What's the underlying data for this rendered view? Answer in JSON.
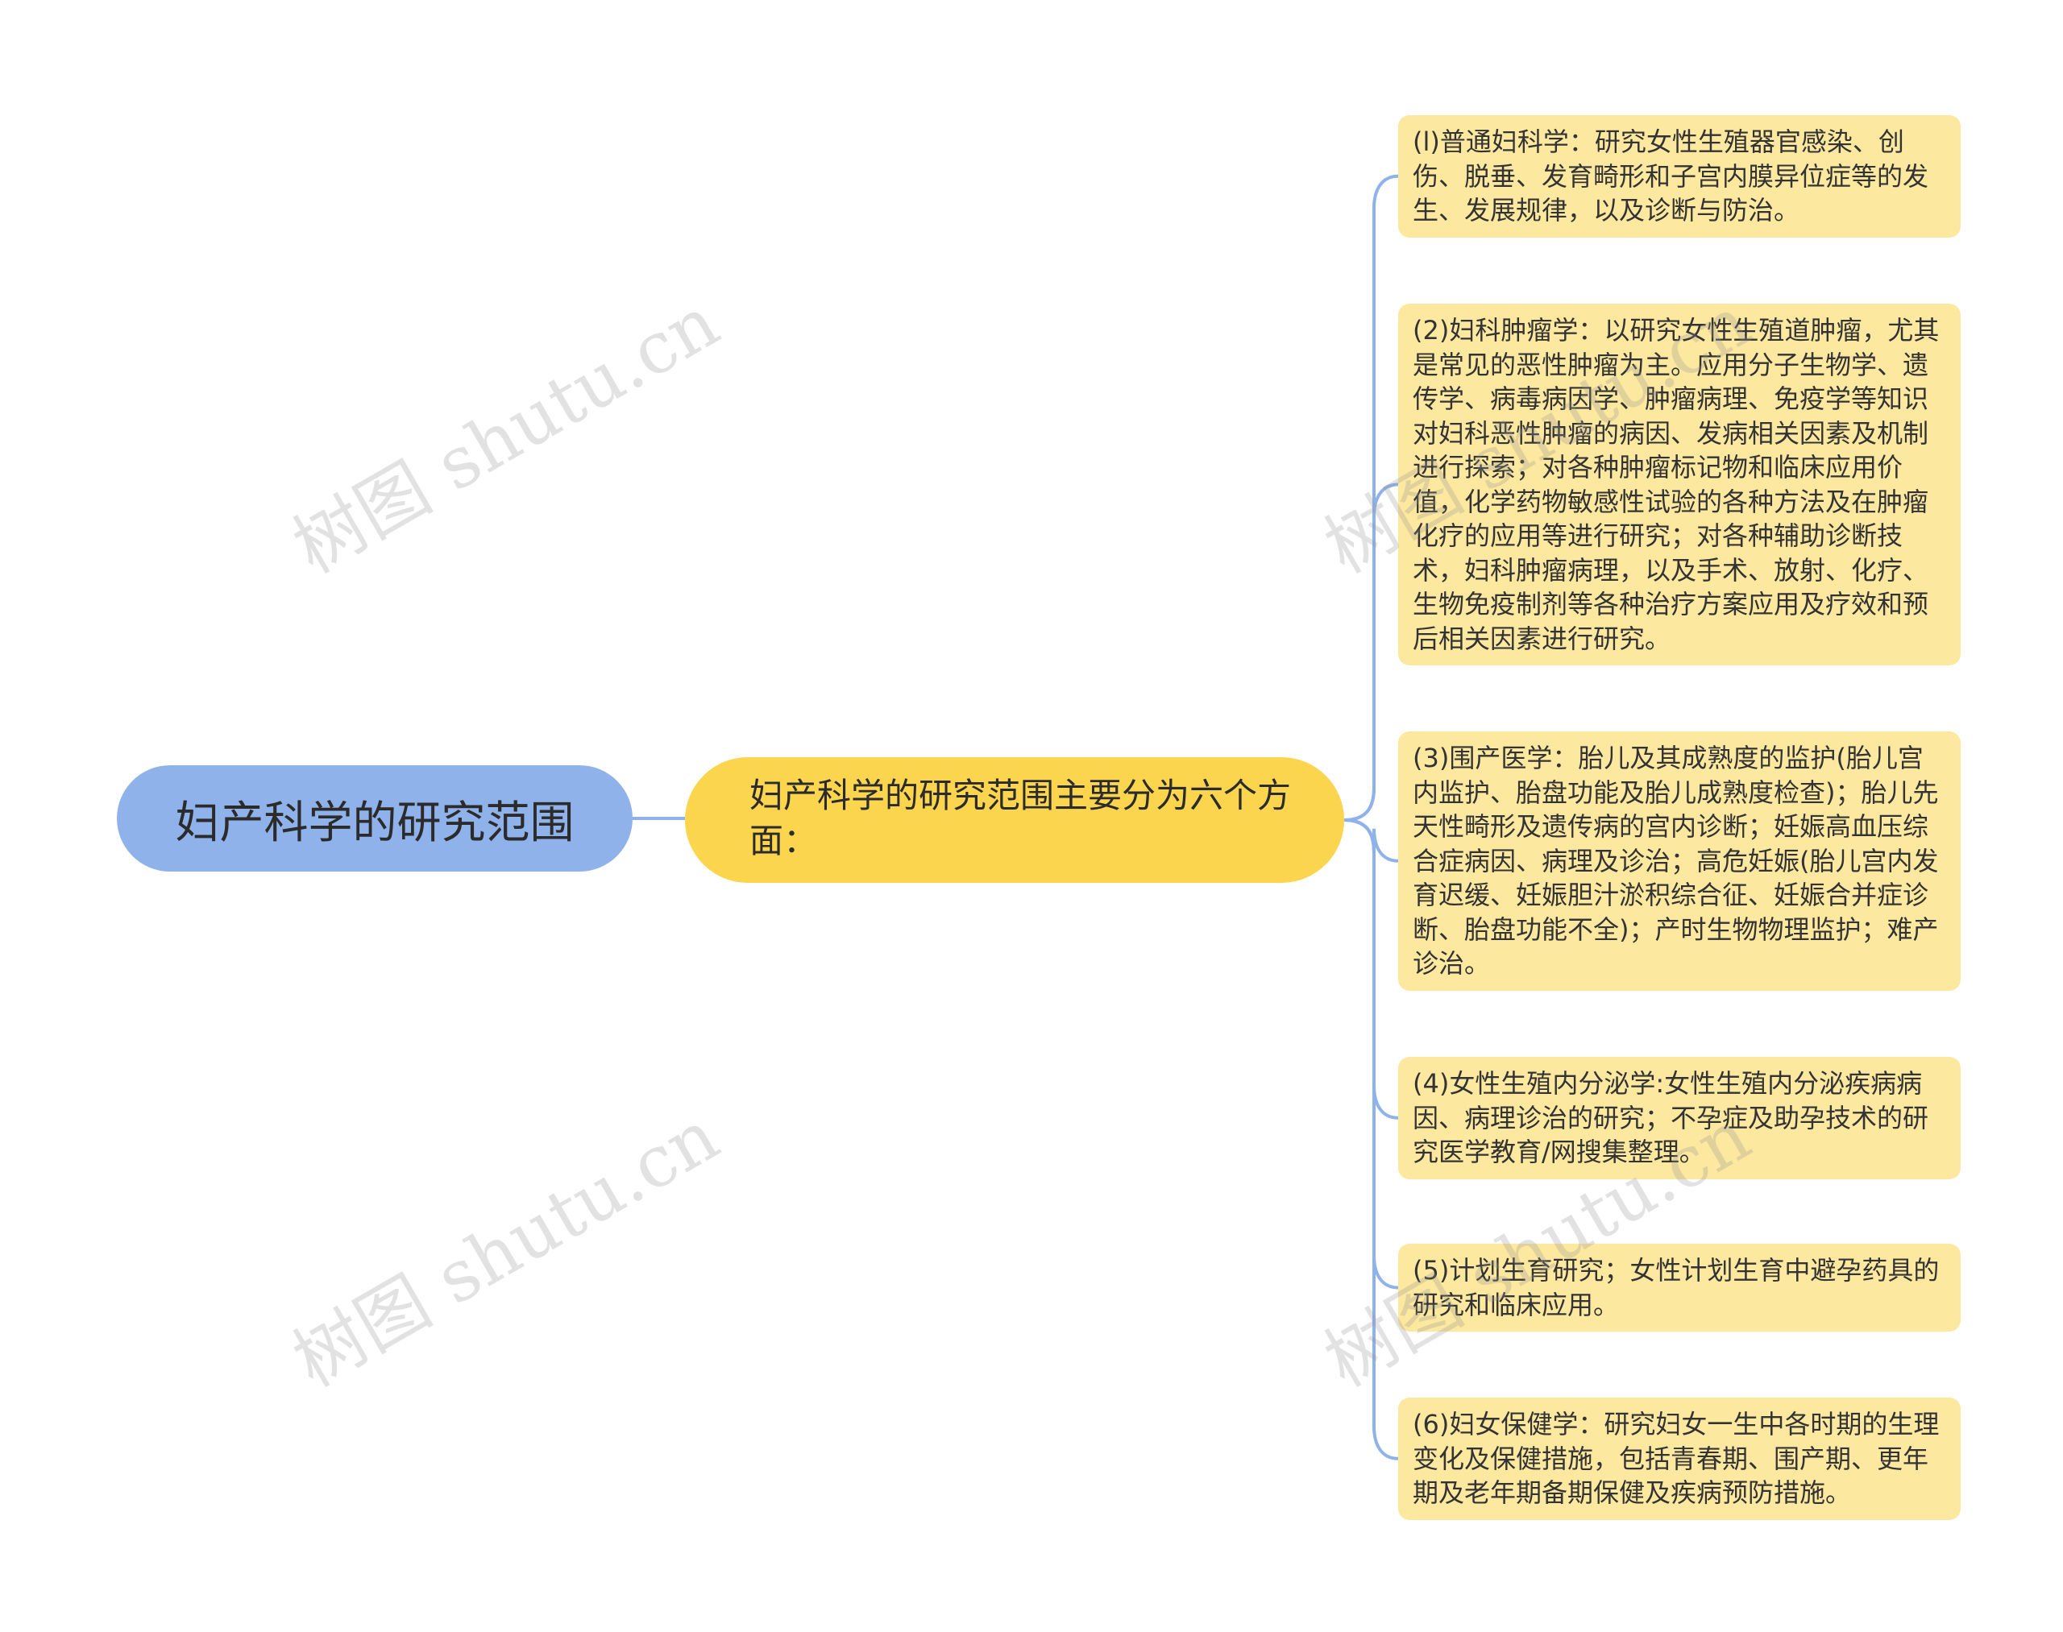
{
  "root": {
    "label": "妇产科学的研究范围"
  },
  "center": {
    "label": "妇产科学的研究范围主要分为六个方面："
  },
  "leaves": [
    {
      "text": "(l)普通妇科学：研究女性生殖器官感染、创伤、脱垂、发育畸形和子宫内膜异位症等的发生、发展规律，以及诊断与防治。"
    },
    {
      "text": "(2)妇科肿瘤学：以研究女性生殖道肿瘤，尤其是常见的恶性肿瘤为主。应用分子生物学、遗传学、病毒病因学、肿瘤病理、免疫学等知识对妇科恶性肿瘤的病因、发病相关因素及机制进行探索；对各种肿瘤标记物和临床应用价值，化学药物敏感性试验的各种方法及在肿瘤化疗的应用等进行研究；对各种辅助诊断技术，妇科肿瘤病理，以及手术、放射、化疗、生物免疫制剂等各种治疗方案应用及疗效和预后相关因素进行研究。"
    },
    {
      "text": "(3)围产医学：胎儿及其成熟度的监护(胎儿宫内监护、胎盘功能及胎儿成熟度检查)；胎儿先天性畸形及遗传病的宫内诊断；妊娠高血压综合症病因、病理及诊治；高危妊娠(胎儿宫内发育迟缓、妊娠胆汁淤积综合征、妊娠合并症诊断、胎盘功能不全)；产时生物物理监护；难产诊治。"
    },
    {
      "text": "(4)女性生殖内分泌学:女性生殖内分泌疾病病因、病理诊治的研究；不孕症及助孕技术的研究医学教育/网搜集整理。"
    },
    {
      "text": "(5)计划生育研究；女性计划生育中避孕药具的研究和临床应用。"
    },
    {
      "text": "(6)妇女保健学：研究妇女一生中各时期的生理变化及保健措施，包括青春期、围产期、更年期及老年期备期保健及疾病预防措施。"
    }
  ],
  "watermark": {
    "text": "树图 shutu.cn"
  },
  "colors": {
    "root_fill": "#8fb2ea",
    "center_fill": "#fcd54f",
    "leaf_fill": "#fde89f",
    "connector": "#8fb2ea",
    "background": "#ffffff"
  }
}
